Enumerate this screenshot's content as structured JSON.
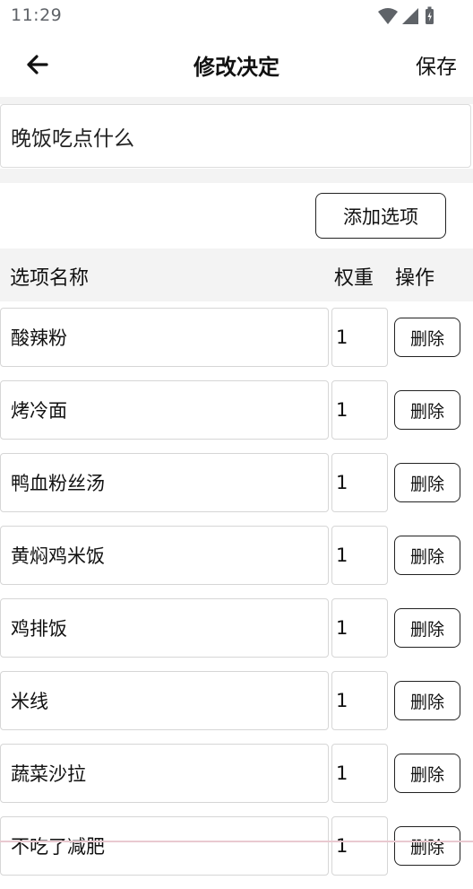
{
  "status_bar": {
    "time": "11:29",
    "icons": [
      "wifi-icon",
      "signal-icon",
      "battery-icon"
    ]
  },
  "app_bar": {
    "back_icon": "arrow-left-icon",
    "title": "修改决定",
    "save_label": "保存"
  },
  "decision": {
    "title_value": "晚饭吃点什么"
  },
  "add_option_label": "添加选项",
  "table": {
    "headers": {
      "name": "选项名称",
      "weight": "权重",
      "action": "操作"
    },
    "delete_label": "删除",
    "rows": [
      {
        "name": "酸辣粉",
        "weight": "1"
      },
      {
        "name": "烤冷面",
        "weight": "1"
      },
      {
        "name": "鸭血粉丝汤",
        "weight": "1"
      },
      {
        "name": "黄焖鸡米饭",
        "weight": "1"
      },
      {
        "name": "鸡排饭",
        "weight": "1"
      },
      {
        "name": "米线",
        "weight": "1"
      },
      {
        "name": "蔬菜沙拉",
        "weight": "1"
      },
      {
        "name": "不吃了减肥",
        "weight": "1"
      }
    ]
  },
  "colors": {
    "background": "#ffffff",
    "band": "#f3f3f3",
    "border": "#d6d6d6",
    "text": "#111111",
    "status_text": "#5f6368"
  }
}
